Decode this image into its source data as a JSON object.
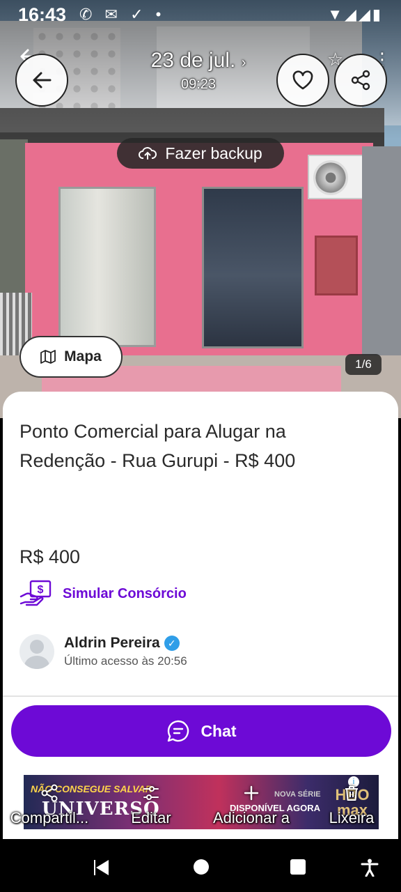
{
  "status_bar": {
    "time": "16:43",
    "left_icons": "✆ ✉ ✓ •",
    "right_icons": "▼◢◢▮"
  },
  "photo": {
    "date_title": "23 de jul.",
    "date_chevron": "›",
    "time": "09:23",
    "backup_label": "Fazer backup",
    "map_label": "Mapa",
    "counter": "1/6",
    "star_glyph": "☆",
    "menu_glyph": "⋮"
  },
  "listing": {
    "title": "Ponto Comercial para Alugar na Redenção - Rua Gurupi - R$ 400",
    "price": "R$ 400",
    "consorcio_label": "Simular Consórcio",
    "seller_name": "Aldrin Pereira",
    "seller_access": "Último acesso  às 20:56",
    "chat_label": "Chat"
  },
  "ad": {
    "line1": "NÃO CONSEGUE SALVAR",
    "line2": "UNIVERSO",
    "line3": "NOVA SÉRIE",
    "line4": "DISPONÍVEL AGORA",
    "brand": "HBO max",
    "info": "i"
  },
  "gallery_actions": [
    {
      "label": "Compartil...",
      "icon": "share-icon"
    },
    {
      "label": "Editar",
      "icon": "edit-sliders-icon"
    },
    {
      "label": "Adicionar a",
      "icon": "plus-icon"
    },
    {
      "label": "Lixeira",
      "icon": "trash-icon"
    }
  ],
  "colors": {
    "accent": "#6d0ad6",
    "verified": "#2f9ee8"
  }
}
